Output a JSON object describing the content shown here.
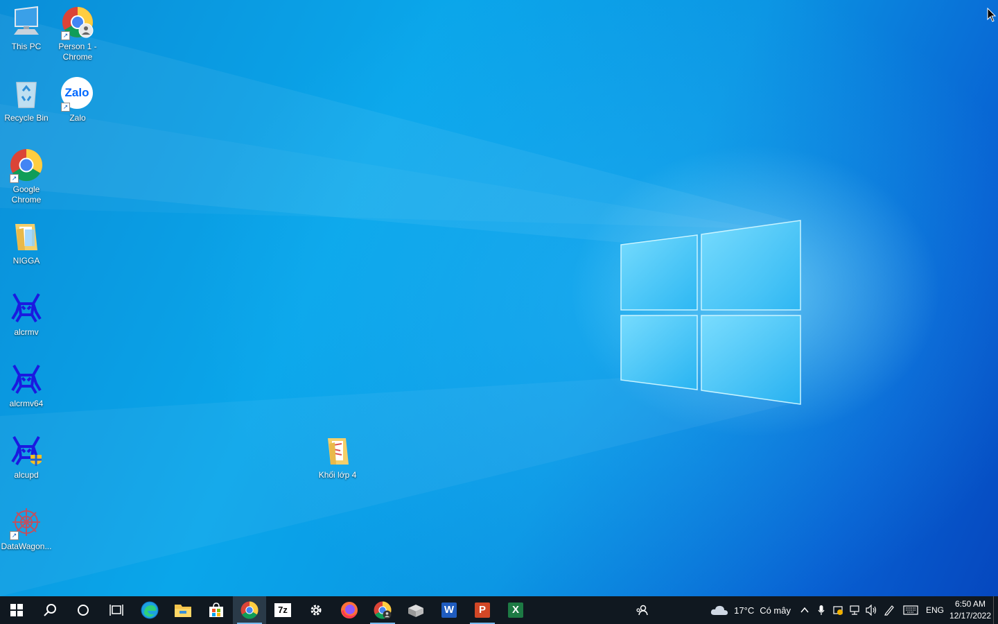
{
  "desktop": {
    "icons": [
      {
        "label": "This PC"
      },
      {
        "label": "Person 1 - Chrome"
      },
      {
        "label": "Recycle Bin"
      },
      {
        "label": "Zalo"
      },
      {
        "label": "Google Chrome"
      },
      {
        "label": "NIGGA"
      },
      {
        "label": "alcrmv"
      },
      {
        "label": "alcrmv64"
      },
      {
        "label": "alcupd"
      },
      {
        "label": "DataWagon..."
      },
      {
        "label": "Khối lớp 4"
      }
    ],
    "zalo_logo_text": "Zalo",
    "shortcut_glyph": "↗"
  },
  "taskbar": {
    "apps": [
      {
        "name": "start-icon"
      },
      {
        "name": "search-icon"
      },
      {
        "name": "cortana-icon"
      },
      {
        "name": "task-view-icon"
      },
      {
        "name": "edge-icon"
      },
      {
        "name": "file-explorer-icon"
      },
      {
        "name": "microsoft-store-icon"
      },
      {
        "name": "chrome-icon",
        "active": true
      },
      {
        "name": "7zip-icon",
        "text": "7z"
      },
      {
        "name": "settings-icon"
      },
      {
        "name": "firefox-icon"
      },
      {
        "name": "chrome-profile-icon",
        "active": true
      },
      {
        "name": "package-icon"
      },
      {
        "name": "word-icon",
        "text": "W"
      },
      {
        "name": "powerpoint-icon",
        "text": "P",
        "active": true
      },
      {
        "name": "excel-icon",
        "text": "X"
      }
    ],
    "weather": {
      "temp": "17°C",
      "condition": "Có mây"
    },
    "language": "ENG",
    "time": "6:50 AM",
    "date": "12/17/2022",
    "chevron": "^"
  },
  "colors": {
    "taskbar_bg": "#101820",
    "accent": "#76b9ed",
    "desktop_blue": "#0aa6ea"
  }
}
